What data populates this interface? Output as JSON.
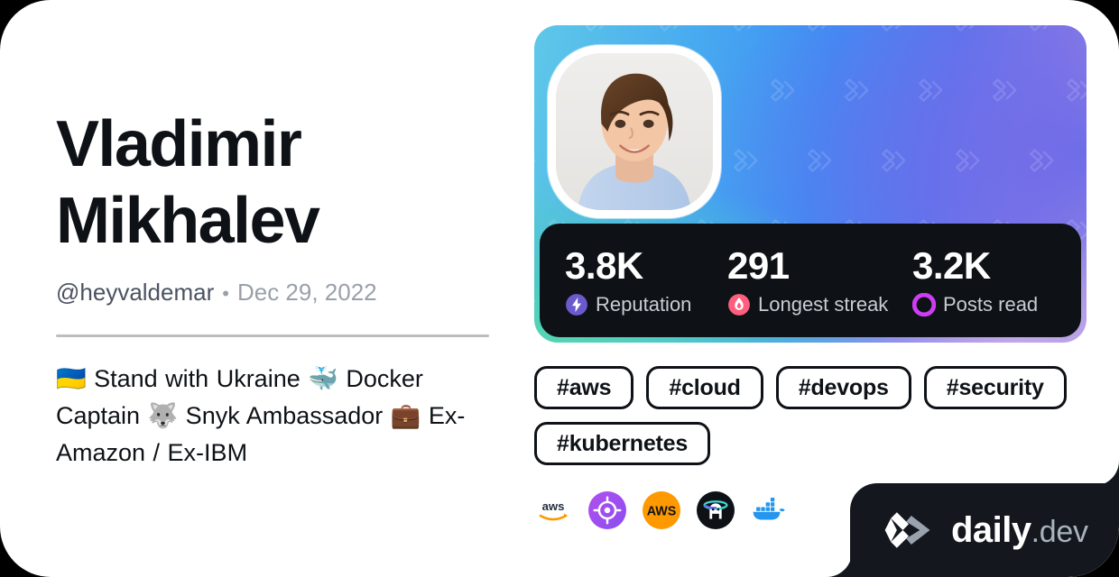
{
  "profile": {
    "name": "Vladimir Mikhalev",
    "name_line1": "Vladimir",
    "name_line2": "Mikhalev",
    "handle": "@heyvaldemar",
    "separator": "•",
    "date": "Dec 29, 2022",
    "bio": "🇺🇦 Stand with Ukraine 🐳 Docker Captain 🐺 Snyk Ambassador 💼 Ex-Amazon / Ex-IBM",
    "avatar_alt": "user-avatar"
  },
  "stats": [
    {
      "value": "3.8K",
      "label": "Reputation",
      "icon": "lightning-bolt-icon",
      "color": "#6a5acd"
    },
    {
      "value": "291",
      "label": "Longest streak",
      "icon": "flame-icon",
      "color": "#ff5e7d"
    },
    {
      "value": "3.2K",
      "label": "Posts read",
      "icon": "ring-icon",
      "color": "#ce3df3"
    }
  ],
  "tags": [
    "#aws",
    "#cloud",
    "#devops",
    "#security",
    "#kubernetes"
  ],
  "badges": [
    {
      "name": "aws-wordmark-badge",
      "color": "#ff9900"
    },
    {
      "name": "target-crosshair-badge",
      "color": "#a855f7"
    },
    {
      "name": "aws-circle-badge",
      "color": "#ff9900"
    },
    {
      "name": "snyk-dog-badge",
      "color": "#0e1217"
    },
    {
      "name": "docker-whale-badge",
      "color": "#2496ed"
    }
  ],
  "brand": {
    "name_bold": "daily",
    "name_light": ".dev",
    "logo": "daily-dev-logo-icon"
  },
  "theme": {
    "card_bg": "#ffffff",
    "text_primary": "#0e1217",
    "text_muted": "#9aa0aa",
    "handle_color": "#4a5261",
    "dark_panel": "#0e1217",
    "brand_panel": "#14181e",
    "divider": "#bdbdbd"
  }
}
